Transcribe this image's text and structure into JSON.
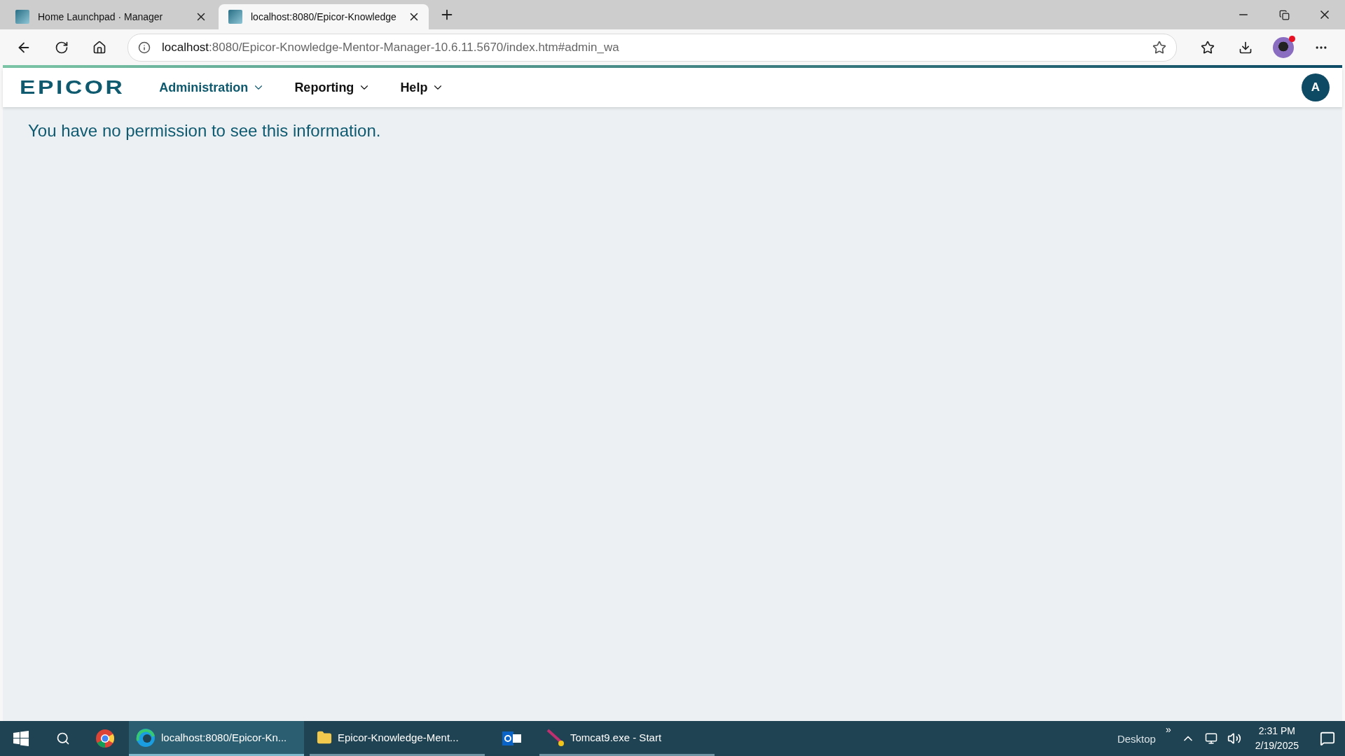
{
  "browser": {
    "tabs": [
      {
        "title": "Home Launchpad · Manager",
        "selected": false
      },
      {
        "title": "localhost:8080/Epicor-Knowledge",
        "selected": true
      }
    ],
    "address": {
      "host": "localhost",
      "path": ":8080/Epicor-Knowledge-Mentor-Manager-10.6.11.5670/index.htm#admin_wa"
    }
  },
  "app": {
    "logo": "EPICOR",
    "menu": [
      {
        "label": "Administration",
        "selected": true
      },
      {
        "label": "Reporting",
        "selected": false
      },
      {
        "label": "Help",
        "selected": false
      }
    ],
    "avatar": "A",
    "message": "You have no permission to see this information."
  },
  "taskbar": {
    "items": [
      {
        "kind": "start"
      },
      {
        "kind": "search"
      },
      {
        "kind": "chrome"
      },
      {
        "kind": "browser",
        "label": "localhost:8080/Epicor-Kn...",
        "selected": true
      },
      {
        "kind": "folder",
        "label": "Epicor-Knowledge-Ment...",
        "selected": false
      },
      {
        "kind": "outlook"
      },
      {
        "kind": "service",
        "label": "Tomcat9.exe - Start",
        "selected": false
      }
    ],
    "toolbar": "Desktop",
    "toolbar_more": "»",
    "time": "2:31 PM",
    "date": "2/19/2025"
  }
}
